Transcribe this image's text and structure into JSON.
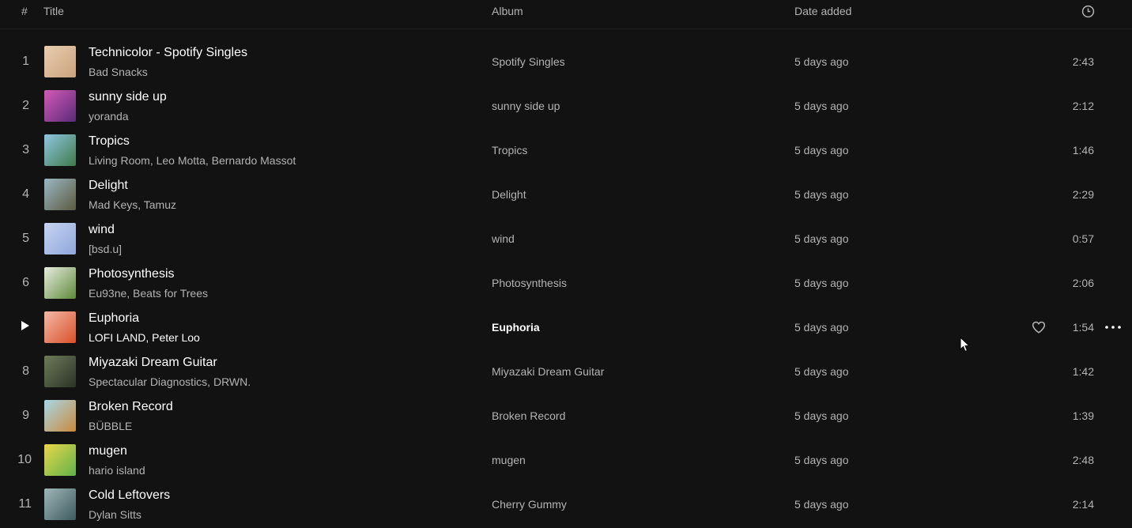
{
  "header": {
    "num_label": "#",
    "title_label": "Title",
    "album_label": "Album",
    "date_label": "Date added",
    "duration_icon": "clock-icon"
  },
  "tracks": [
    {
      "num": "1",
      "title": "Technicolor - Spotify Singles",
      "artist": "Bad Snacks",
      "album": "Spotify Singles",
      "date": "5 days ago",
      "duration": "2:43",
      "cover_colors": [
        "#e8cdb0",
        "#c9a27c"
      ]
    },
    {
      "num": "2",
      "title": "sunny side up",
      "artist": "yoranda",
      "album": "sunny side up",
      "date": "5 days ago",
      "duration": "2:12",
      "cover_colors": [
        "#d45ab8",
        "#5a2a78"
      ]
    },
    {
      "num": "3",
      "title": "Tropics",
      "artist": "Living Room, Leo Motta, Bernardo Massot",
      "album": "Tropics",
      "date": "5 days ago",
      "duration": "1:46",
      "cover_colors": [
        "#8fc6e0",
        "#3f7a4a"
      ]
    },
    {
      "num": "4",
      "title": "Delight",
      "artist": "Mad Keys, Tamuz",
      "album": "Delight",
      "date": "5 days ago",
      "duration": "2:29",
      "cover_colors": [
        "#9bb7c4",
        "#5b5a40"
      ]
    },
    {
      "num": "5",
      "title": "wind",
      "artist": "[bsd.u]",
      "album": "wind",
      "date": "5 days ago",
      "duration": "0:57",
      "cover_colors": [
        "#c7d4f2",
        "#8fa6dc"
      ]
    },
    {
      "num": "6",
      "title": "Photosynthesis",
      "artist": "Eu93ne, Beats for Trees",
      "album": "Photosynthesis",
      "date": "5 days ago",
      "duration": "2:06",
      "cover_colors": [
        "#e8ecdf",
        "#5e8a3a"
      ]
    },
    {
      "num": "7",
      "title": "Euphoria",
      "artist": "LOFI LAND, Peter Loo",
      "album": "Euphoria",
      "date": "5 days ago",
      "duration": "1:54",
      "cover_colors": [
        "#f3b9a6",
        "#d9502a"
      ],
      "active": true
    },
    {
      "num": "8",
      "title": "Miyazaki Dream Guitar",
      "artist": "Spectacular Diagnostics, DRWN.",
      "album": "Miyazaki Dream Guitar",
      "date": "5 days ago",
      "duration": "1:42",
      "cover_colors": [
        "#6f7a5a",
        "#2b3326"
      ]
    },
    {
      "num": "9",
      "title": "Broken Record",
      "artist": "BÜBBLE",
      "album": "Broken Record",
      "date": "5 days ago",
      "duration": "1:39",
      "cover_colors": [
        "#a9d7e8",
        "#c98a3a"
      ]
    },
    {
      "num": "10",
      "title": "mugen",
      "artist": "hario island",
      "album": "mugen",
      "date": "5 days ago",
      "duration": "2:48",
      "cover_colors": [
        "#e9d64a",
        "#5fb24a"
      ]
    },
    {
      "num": "11",
      "title": "Cold Leftovers",
      "artist": "Dylan Sitts",
      "album": "Cherry Gummy",
      "date": "5 days ago",
      "duration": "2:14",
      "cover_colors": [
        "#9fb6b8",
        "#3d5a5e"
      ]
    }
  ]
}
